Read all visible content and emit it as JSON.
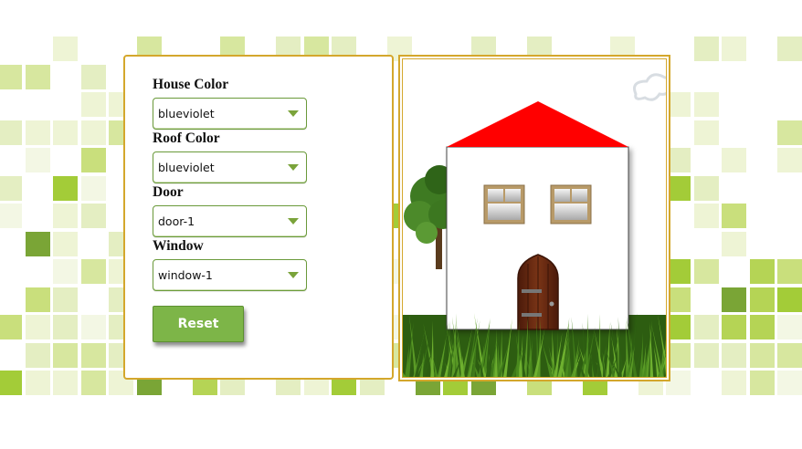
{
  "form": {
    "house_color": {
      "label": "House Color",
      "value": "blueviolet"
    },
    "roof_color": {
      "label": "Roof Color",
      "value": "blueviolet"
    },
    "door": {
      "label": "Door",
      "value": "door-1"
    },
    "window": {
      "label": "Window",
      "value": "window-1"
    },
    "reset_label": "Reset"
  },
  "colors": {
    "panel_border": "#d4a72c",
    "button": "#7db548",
    "house_wall": "#ffffff",
    "roof": "#ff0000",
    "door": "#6b2e12",
    "window_frame": "#b89a68"
  },
  "icons": {
    "select_arrow": "chevron-down-icon"
  }
}
